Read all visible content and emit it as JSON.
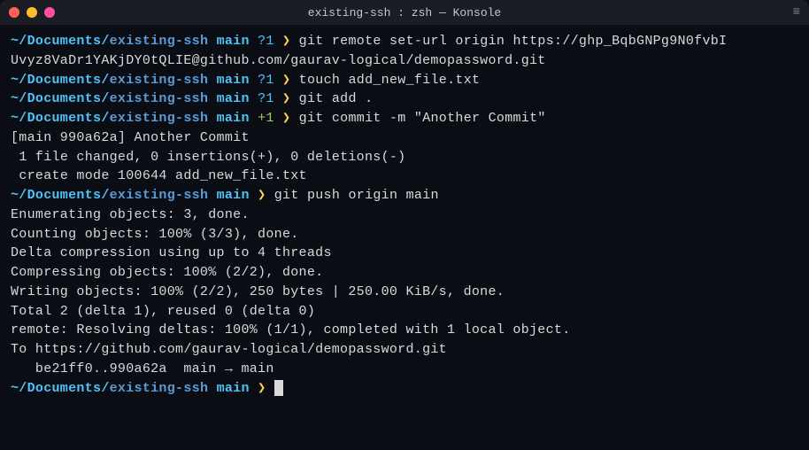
{
  "window": {
    "title": "existing-ssh : zsh — Konsole"
  },
  "prompt": {
    "path": "~/Documents/",
    "dir": "existing-ssh",
    "branch": "main",
    "status_unknown": "?1",
    "status_staged": "+1",
    "arrow": "❯"
  },
  "lines": {
    "cmd1a": "git remote set-url origin https://ghp_BqbGNPg9N0fvbI",
    "cmd1b": "Uvyz8VaDr1YAKjDY0tQLIE@github.com/gaurav-logical/demopassword.git",
    "cmd2": "touch add_new_file.txt",
    "cmd3": "git add .",
    "cmd4": "git commit -m \"Another Commit\"",
    "out1": "[main 990a62a] Another Commit",
    "out2": " 1 file changed, 0 insertions(+), 0 deletions(-)",
    "out3": " create mode 100644 add_new_file.txt",
    "cmd5": "git push origin main",
    "out4": "Enumerating objects: 3, done.",
    "out5": "Counting objects: 100% (3/3), done.",
    "out6": "Delta compression using up to 4 threads",
    "out7": "Compressing objects: 100% (2/2), done.",
    "out8": "Writing objects: 100% (2/2), 250 bytes | 250.00 KiB/s, done.",
    "out9": "Total 2 (delta 1), reused 0 (delta 0)",
    "out10": "remote: Resolving deltas: 100% (1/1), completed with 1 local object.",
    "out11": "To https://github.com/gaurav-logical/demopassword.git",
    "out12": "   be21ff0..990a62a  main → main"
  }
}
